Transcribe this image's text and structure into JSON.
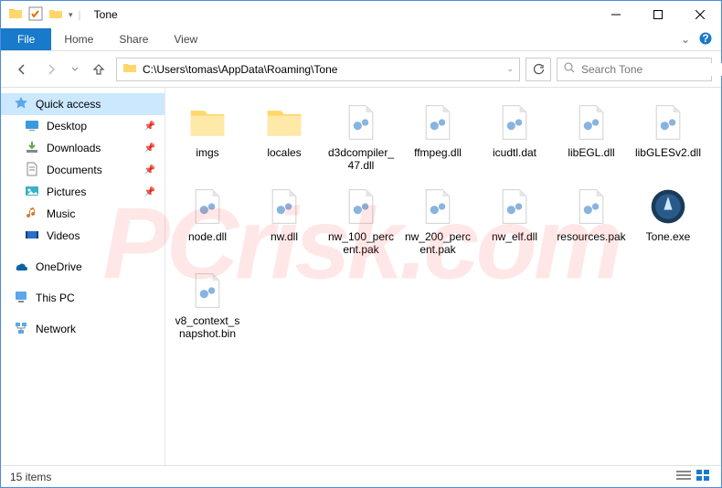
{
  "window": {
    "title": "Tone",
    "address": "C:\\Users\\tomas\\AppData\\Roaming\\Tone",
    "search_placeholder": "Search Tone"
  },
  "ribbon": {
    "file": "File",
    "tabs": [
      "Home",
      "Share",
      "View"
    ]
  },
  "sidebar": {
    "quick_access": "Quick access",
    "items": [
      {
        "label": "Desktop",
        "pinned": true
      },
      {
        "label": "Downloads",
        "pinned": true
      },
      {
        "label": "Documents",
        "pinned": true
      },
      {
        "label": "Pictures",
        "pinned": true
      },
      {
        "label": "Music",
        "pinned": false
      },
      {
        "label": "Videos",
        "pinned": false
      }
    ],
    "onedrive": "OneDrive",
    "this_pc": "This PC",
    "network": "Network"
  },
  "files": [
    {
      "name": "imgs",
      "type": "folder"
    },
    {
      "name": "locales",
      "type": "folder"
    },
    {
      "name": "d3dcompiler_47.dll",
      "type": "dll"
    },
    {
      "name": "ffmpeg.dll",
      "type": "dll"
    },
    {
      "name": "icudtl.dat",
      "type": "file"
    },
    {
      "name": "libEGL.dll",
      "type": "dll"
    },
    {
      "name": "libGLESv2.dll",
      "type": "dll"
    },
    {
      "name": "node.dll",
      "type": "dll"
    },
    {
      "name": "nw.dll",
      "type": "dll"
    },
    {
      "name": "nw_100_percent.pak",
      "type": "file"
    },
    {
      "name": "nw_200_percent.pak",
      "type": "file"
    },
    {
      "name": "nw_elf.dll",
      "type": "dll"
    },
    {
      "name": "resources.pak",
      "type": "file"
    },
    {
      "name": "Tone.exe",
      "type": "exe"
    },
    {
      "name": "v8_context_snapshot.bin",
      "type": "file"
    }
  ],
  "status": {
    "count_label": "15 items"
  },
  "watermark": "PCrisk.com"
}
